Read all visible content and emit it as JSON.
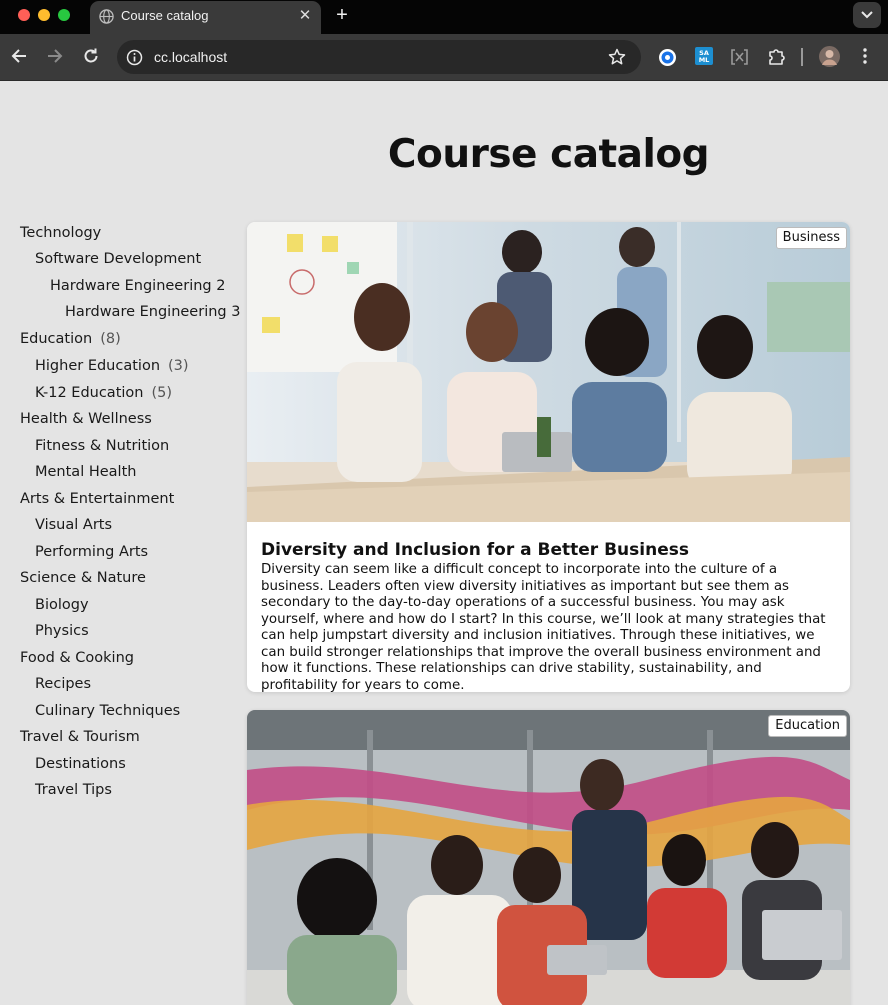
{
  "browser": {
    "tab_title": "Course catalog",
    "url": "cc.localhost"
  },
  "page": {
    "title": "Course catalog"
  },
  "categories": [
    {
      "label": "Technology",
      "count": ""
    },
    {
      "label": "Software Development",
      "count": ""
    },
    {
      "label": "Hardware Engineering 2",
      "count": ""
    },
    {
      "label": "Hardware Engineering 3",
      "count": ""
    },
    {
      "label": "Education",
      "count": "(8)"
    },
    {
      "label": "Higher Education",
      "count": "(3)"
    },
    {
      "label": "K-12 Education",
      "count": "(5)"
    },
    {
      "label": "Health & Wellness",
      "count": ""
    },
    {
      "label": "Fitness & Nutrition",
      "count": ""
    },
    {
      "label": "Mental Health",
      "count": ""
    },
    {
      "label": "Arts & Entertainment",
      "count": ""
    },
    {
      "label": "Visual Arts",
      "count": ""
    },
    {
      "label": "Performing Arts",
      "count": ""
    },
    {
      "label": "Science & Nature",
      "count": ""
    },
    {
      "label": "Biology",
      "count": ""
    },
    {
      "label": "Physics",
      "count": ""
    },
    {
      "label": "Food & Cooking",
      "count": ""
    },
    {
      "label": "Recipes",
      "count": ""
    },
    {
      "label": "Culinary Techniques",
      "count": ""
    },
    {
      "label": "Travel & Tourism",
      "count": ""
    },
    {
      "label": "Destinations",
      "count": ""
    },
    {
      "label": "Travel Tips",
      "count": ""
    }
  ],
  "courses": [
    {
      "tag": "Business",
      "title": "Diversity and Inclusion for a Better Business",
      "description": "Diversity can seem like a difficult concept to incorporate into the culture of a business. Leaders often view diversity initiatives as important but see them as secondary to the day-to-day operations of a successful business. You may ask yourself, where and how do I start? In this course, we’ll look at many strategies that can help jumpstart diversity and inclusion initiatives. Through these initiatives, we can build stronger relationships that improve the overall business environment and how it functions. These relationships can drive stability, sustainability, and profitability for years to come."
    },
    {
      "tag": "Education",
      "title": "",
      "description": ""
    }
  ]
}
